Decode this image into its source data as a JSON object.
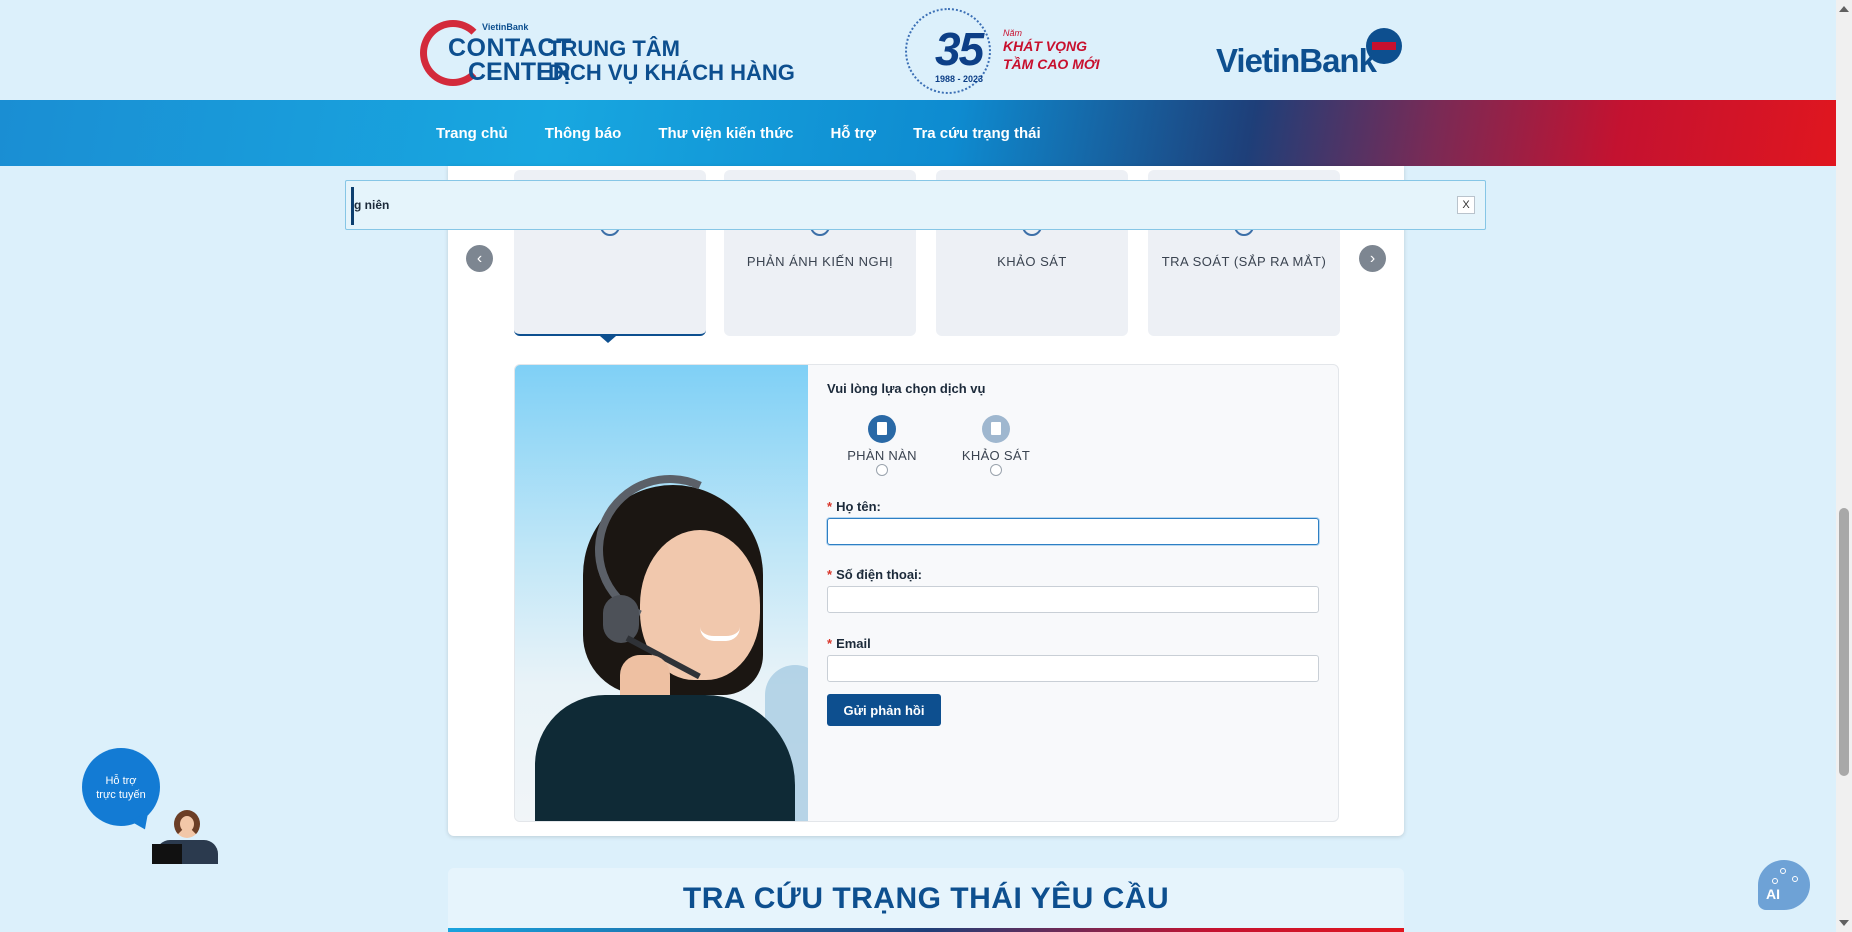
{
  "header": {
    "contact_center": {
      "small_brand": "VietinBank",
      "contact": "CONTACT",
      "center": "CENTER",
      "title_line1": "TRUNG TÂM",
      "title_line2": "DỊCH VỤ KHÁCH HÀNG"
    },
    "anniversary": {
      "number": "35",
      "unit": "Năm",
      "slogan_line1": "KHÁT VỌNG",
      "slogan_line2": "TẦM CAO MỚI",
      "years": "1988 - 2023"
    },
    "bank_logo": "VietinBank"
  },
  "nav": {
    "items": [
      "Trang chủ",
      "Thông báo",
      "Thư viện kiến thức",
      "Hỗ trợ",
      "Tra cứu trạng thái"
    ]
  },
  "tiles": [
    {
      "label": "",
      "active": true
    },
    {
      "label": "PHẢN ÁNH KIẾN NGHỊ",
      "active": false
    },
    {
      "label": "KHẢO SÁT",
      "active": false
    },
    {
      "label": "TRA SOÁT (SẮP RA MẮT)",
      "active": false
    }
  ],
  "carousel": {
    "prev": "‹",
    "next": "›"
  },
  "toast": {
    "text": "g niên",
    "close": "X"
  },
  "form": {
    "service_prompt": "Vui lòng lựa chọn dịch vụ",
    "services": [
      "PHÀN NÀN",
      "KHẢO SÁT"
    ],
    "name_label": "Họ tên:",
    "name_value": "",
    "phone_label": "Số điện thoại:",
    "phone_value": "",
    "email_label": "Email",
    "email_value": "",
    "required_mark": "*",
    "submit_label": "Gửi phản hồi"
  },
  "lookup": {
    "title": "TRA CỨU TRẠNG THÁI YÊU CẦU"
  },
  "support": {
    "line1": "Hỗ trợ",
    "line2": "trực tuyến"
  },
  "ai_button": {
    "label": "AI"
  },
  "colors": {
    "brand_blue": "#0d4f8f",
    "brand_red": "#c8102e",
    "page_bg": "#dcf0fb"
  }
}
